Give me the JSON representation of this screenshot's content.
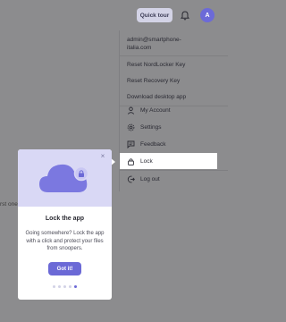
{
  "header": {
    "quick_tour_label": "Quick tour",
    "avatar_initial": "A"
  },
  "background": {
    "left_text": "rst one"
  },
  "menu": {
    "email": "admin@smartphone-italia.com",
    "items": [
      {
        "label": "Reset NordLocker Key",
        "icon": "none"
      },
      {
        "label": "Reset Recovery Key",
        "icon": "none"
      },
      {
        "label": "Download desktop app",
        "icon": "none"
      },
      {
        "label": "My Account",
        "icon": "user-icon"
      },
      {
        "label": "Settings",
        "icon": "gear-icon"
      },
      {
        "label": "Feedback",
        "icon": "feedback-icon"
      },
      {
        "label": "Lock",
        "icon": "lock-icon"
      },
      {
        "label": "Log out",
        "icon": "logout-icon"
      }
    ]
  },
  "popover": {
    "title": "Lock the app",
    "text": "Going somewhere? Lock the app with a click and protect your files from snoopers.",
    "button_label": "Got it!",
    "step_current": 5,
    "step_total": 5
  },
  "colors": {
    "accent": "#6b69d6",
    "overlay": "#8c8c8e",
    "art_bg": "#d9d8f5"
  }
}
